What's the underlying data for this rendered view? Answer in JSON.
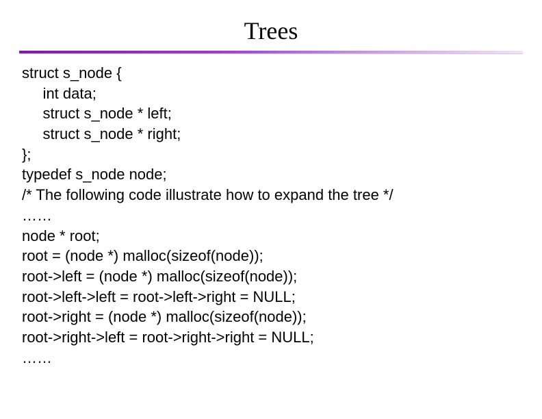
{
  "title": "Trees",
  "code": {
    "l1": "struct s_node {",
    "l2": "     int data;",
    "l3": "     struct s_node * left;",
    "l4": "     struct s_node * right;",
    "l5": "};",
    "l6": "typedef s_node node;",
    "l7": "/* The following code illustrate how to expand the tree */",
    "l8": "……",
    "l9": "node * root;",
    "l10": "root = (node *) malloc(sizeof(node));",
    "l11": "root->left = (node *) malloc(sizeof(node));",
    "l12": "root->left->left = root->left->right = NULL;",
    "l13": "root->right = (node *) malloc(sizeof(node));",
    "l14": "root->right->left = root->right->right = NULL;",
    "l15": "……"
  }
}
